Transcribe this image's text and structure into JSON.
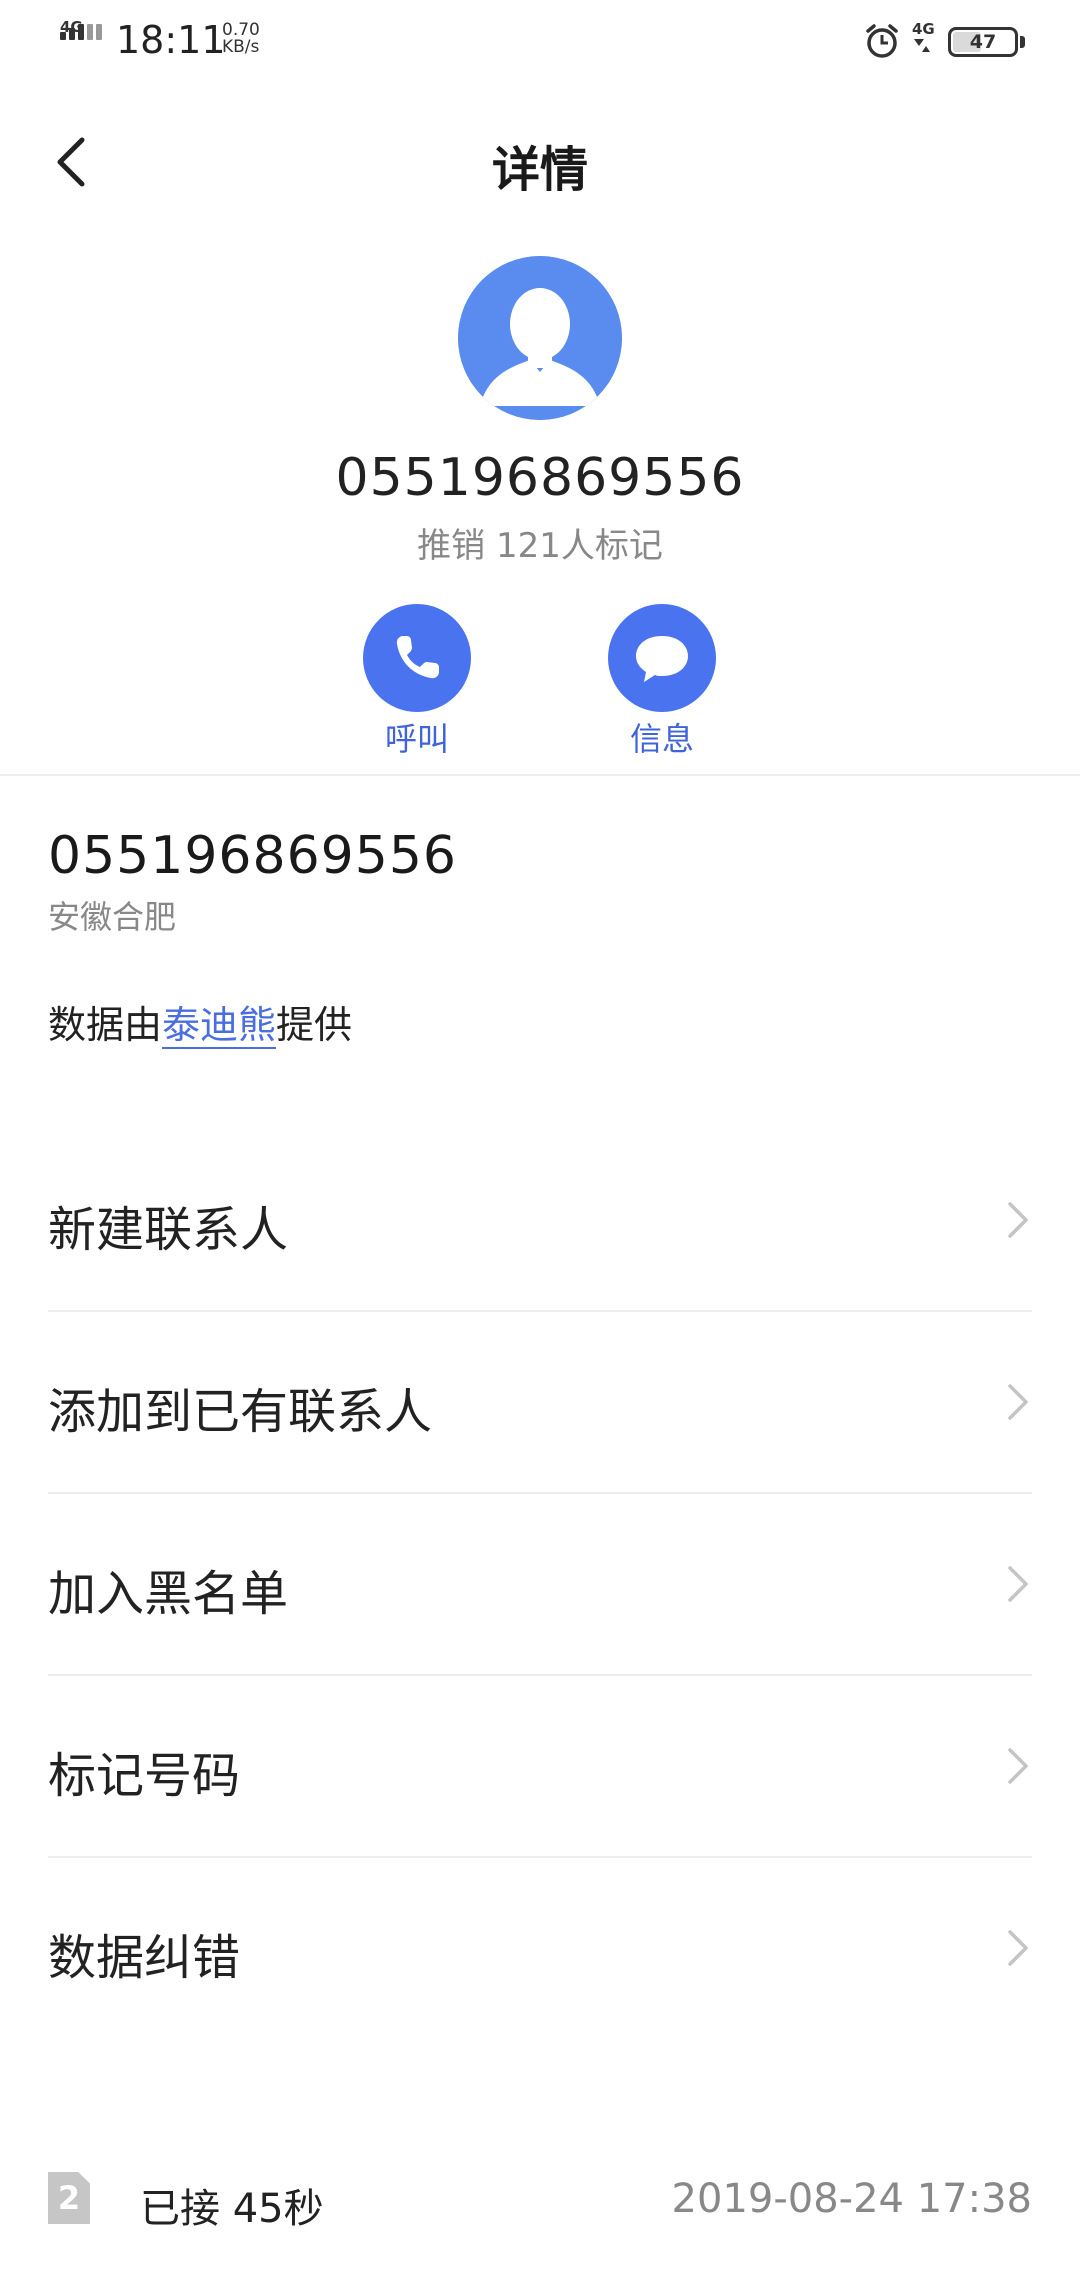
{
  "status_bar": {
    "network_left": "4G",
    "time": "18:11",
    "speed_value": "0.70",
    "speed_unit": "KB/s",
    "network_right": "4G",
    "battery": "47",
    "battery_level": 0.47
  },
  "title_bar": {
    "title": "详情",
    "back_icon": "chevron-left-icon"
  },
  "header": {
    "avatar_icon": "person-silhouette-icon",
    "avatar_color": "#5A8CF0",
    "number": "055196869556",
    "tags": "推销 121人标记"
  },
  "actions": [
    {
      "label": "呼叫",
      "icon": "phone-icon"
    },
    {
      "label": "信息",
      "icon": "chat-bubble-icon"
    }
  ],
  "info": {
    "number": "055196869556",
    "location": "安徽合肥",
    "provider_prefix": "数据由",
    "provider_name": "泰迪熊",
    "provider_suffix": "提供"
  },
  "menu": [
    {
      "label": "新建联系人"
    },
    {
      "label": "添加到已有联系人"
    },
    {
      "label": "加入黑名单"
    },
    {
      "label": "标记号码"
    },
    {
      "label": "数据纠错"
    }
  ],
  "call_log": {
    "sim": "2",
    "status": "已接 45秒",
    "datetime": "2019-08-24 17:38"
  },
  "colors": {
    "accent": "#4A73F0",
    "accent_text": "#3F63D8",
    "secondary_text": "#888888"
  }
}
